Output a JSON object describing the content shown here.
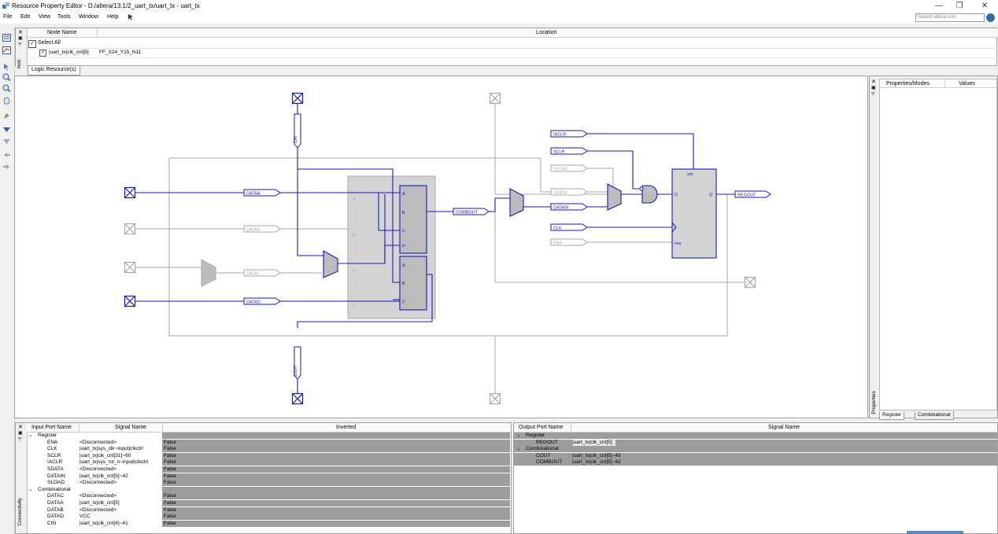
{
  "window": {
    "title": "Resource Property Editor - D:/altera/13.1/2_uart_tx/uart_tx - uart_tx",
    "minimize": "—",
    "restore": "❐",
    "close": "✕"
  },
  "menu": {
    "items": [
      "File",
      "Edit",
      "View",
      "Tools",
      "Window",
      "Help"
    ]
  },
  "search": {
    "placeholder": "Search altera.com"
  },
  "node_panel": {
    "col_node_name": "Node Name",
    "col_location": "Location",
    "select_all": "Select All",
    "node": "|uart_tx|clk_cnt[5]",
    "location": "FF_X24_Y15_N11",
    "side_label": "Nod",
    "tab": "Logic Resource(s)"
  },
  "schematic": {
    "labels": {
      "dataa": "DATAA",
      "datab": "DATAB",
      "datac": "DATAC",
      "datad": "DATAD",
      "combout": "COMBOUT",
      "aclr": "!ACLR",
      "sclr": "SCLR",
      "sload": "SLOAD",
      "sdata": "SDATA",
      "datain": "DATAIN",
      "clk": "CLK",
      "ena": "ENA",
      "regout": "REGOUT",
      "cin": "CIN",
      "cout": "COUT",
      "lut_a": "A",
      "lut_b": "B",
      "lut_c": "C",
      "lut_d": "D",
      "ff_d": "D",
      "ff_q": "Q",
      "ff_aclr": "aclr",
      "ff_ena": "ena"
    }
  },
  "properties": {
    "col_props": "Properties/Modes",
    "col_values": "Values",
    "side_label": "Properties",
    "tabs": [
      "Register",
      "Combinational"
    ]
  },
  "input_ports": {
    "headers": {
      "port": "Input Port Name",
      "signal": "Signal Name",
      "inverted": "Inverted"
    },
    "side_label": "Connectivity",
    "groups": [
      {
        "name": "Register",
        "rows": [
          {
            "port": "ENA",
            "signal": "<Disconnected>",
            "inverted": "False"
          },
          {
            "port": "CLK",
            "signal": "|uart_tx|sys_clk~input|clkctrl",
            "inverted": "False"
          },
          {
            "port": "SCLR",
            "signal": "|uart_tx|clk_cnt[31]~60",
            "inverted": "False"
          },
          {
            "port": "!ACLR",
            "signal": "|uart_tx|sys_rst_n~input|clkctrl",
            "inverted": "False"
          },
          {
            "port": "SDATA",
            "signal": "<Disconnected>",
            "inverted": "False"
          },
          {
            "port": "DATAIN",
            "signal": "|uart_tx|clk_cnt[5]~42",
            "inverted": "False"
          },
          {
            "port": "SLOAD",
            "signal": "<Disconnected>",
            "inverted": "False"
          }
        ]
      },
      {
        "name": "Combinational",
        "rows": [
          {
            "port": "DATAC",
            "signal": "<Disconnected>",
            "inverted": "False"
          },
          {
            "port": "DATAA",
            "signal": "|uart_tx|clk_cnt[5]",
            "inverted": "False"
          },
          {
            "port": "DATAB",
            "signal": "<Disconnected>",
            "inverted": "False"
          },
          {
            "port": "DATAD",
            "signal": "VCC",
            "inverted": "False"
          },
          {
            "port": "CIN",
            "signal": "|uart_tx|clk_cnt[4]~41",
            "inverted": "False"
          }
        ]
      }
    ]
  },
  "output_ports": {
    "headers": {
      "port": "Output Port Name",
      "signal": "Signal Name"
    },
    "groups": [
      {
        "name": "Register",
        "rows": [
          {
            "port": "REGOUT",
            "signal": "|uart_tx|clk_cnt[5]"
          }
        ]
      },
      {
        "name": "Combinational",
        "rows": [
          {
            "port": "COUT",
            "signal": "|uart_tx|clk_cnt[5]~43"
          },
          {
            "port": "COMBOUT",
            "signal": "|uart_tx|clk_cnt[5]~42"
          }
        ]
      }
    ]
  },
  "colors": {
    "active": "#1a1ab4",
    "inactive": "#a8a8a8",
    "block_fill": "#d4d4d4",
    "row_gray": "#9d9d9d"
  }
}
